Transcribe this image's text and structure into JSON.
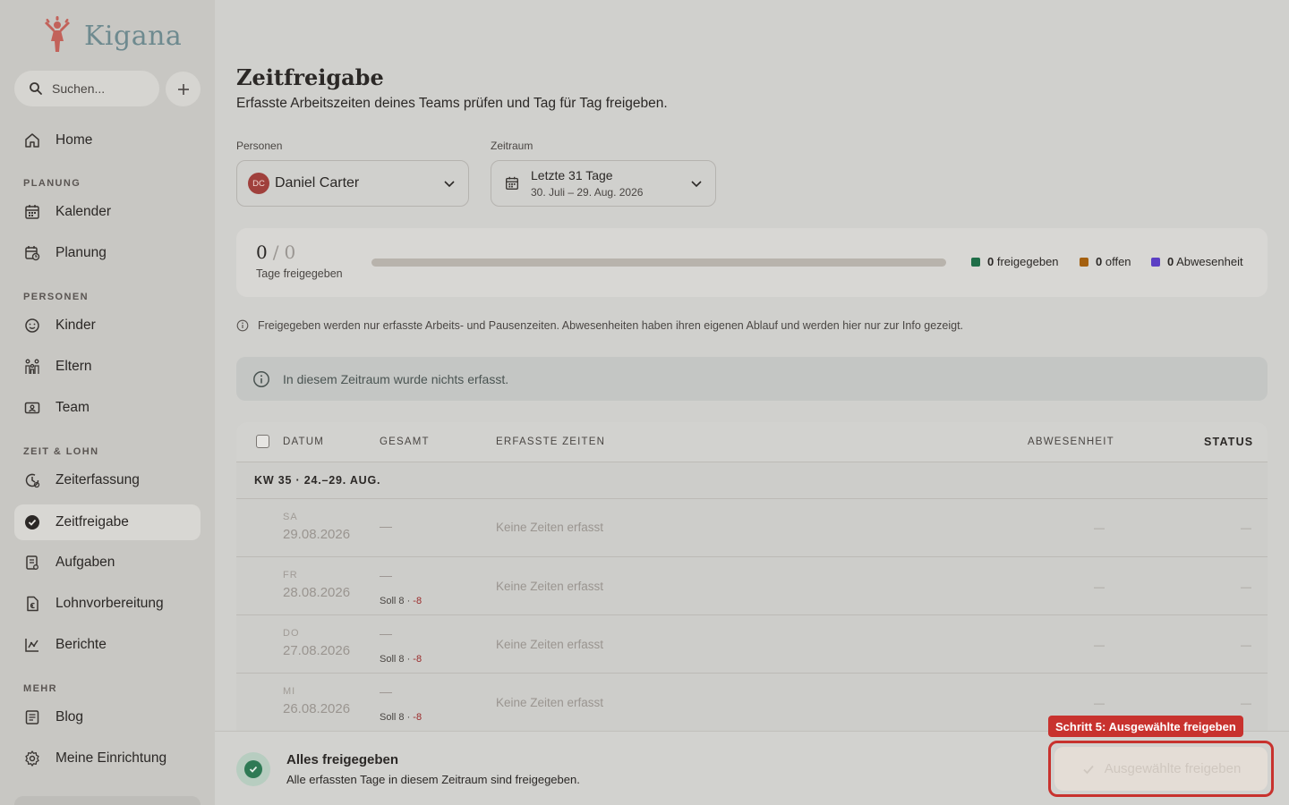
{
  "brand": {
    "name": "Kigana"
  },
  "search": {
    "placeholder": "Suchen..."
  },
  "sidebar": {
    "home": "Home",
    "sections": [
      "PLANUNG",
      "PERSONEN",
      "ZEIT & LOHN",
      "MEHR"
    ],
    "items": {
      "kalender": "Kalender",
      "planung": "Planung",
      "kinder": "Kinder",
      "eltern": "Eltern",
      "team": "Team",
      "zeiterfassung": "Zeiterfassung",
      "zeitfreigabe": "Zeitfreigabe",
      "aufgaben": "Aufgaben",
      "lohnvorbereitung": "Lohnvorbereitung",
      "berichte": "Berichte",
      "blog": "Blog",
      "einrichtung": "Meine Einrichtung"
    },
    "active": "zeitfreigabe"
  },
  "page": {
    "title": "Zeitfreigabe",
    "subtitle": "Erfasste Arbeitszeiten deines Teams prüfen und Tag für Tag freigeben."
  },
  "filters": {
    "persons_label": "Personen",
    "person_initials": "DC",
    "person_name": "Daniel Carter",
    "range_label": "Zeitraum",
    "range_title": "Letzte 31 Tage",
    "range_dates": "30. Juli – 29. Aug. 2026"
  },
  "summary": {
    "approved": "0",
    "total": "0",
    "label": "Tage freigegeben",
    "progress": 0,
    "legend": [
      {
        "count": "0",
        "label": "freigegeben",
        "color": "#1f6e48"
      },
      {
        "count": "0",
        "label": "offen",
        "color": "#a4600f"
      },
      {
        "count": "0",
        "label": "Abwesenheit",
        "color": "#5b3fc4"
      }
    ]
  },
  "notes": {
    "info": "Freigegeben werden nur erfasste Arbeits- und Pausenzeiten. Abwesenheiten haben ihren eigenen Ablauf und werden hier nur zur Info gezeigt.",
    "empty": "In diesem Zeitraum wurde nichts erfasst."
  },
  "table": {
    "columns": {
      "date": "DATUM",
      "total": "GESAMT",
      "times": "ERFASSTE ZEITEN",
      "absence": "ABWESENHEIT",
      "status": "STATUS"
    },
    "week": "KW 35 · 24.–29. AUG.",
    "rows": [
      {
        "weekday": "SA",
        "date": "29.08.2026",
        "total": "—",
        "soll": "",
        "diff": "",
        "times": "Keine Zeiten erfasst",
        "absence": "—",
        "status": "—"
      },
      {
        "weekday": "FR",
        "date": "28.08.2026",
        "total": "—",
        "soll": "Soll 8 · ",
        "diff": "-8",
        "times": "Keine Zeiten erfasst",
        "absence": "—",
        "status": "—"
      },
      {
        "weekday": "DO",
        "date": "27.08.2026",
        "total": "—",
        "soll": "Soll 8 · ",
        "diff": "-8",
        "times": "Keine Zeiten erfasst",
        "absence": "—",
        "status": "—"
      },
      {
        "weekday": "MI",
        "date": "26.08.2026",
        "total": "—",
        "soll": "Soll 8 · ",
        "diff": "-8",
        "times": "Keine Zeiten erfasst",
        "absence": "—",
        "status": "—"
      }
    ]
  },
  "footer": {
    "title": "Alles freigegeben",
    "subtitle": "Alle erfassten Tage in diesem Zeitraum sind freigegeben.",
    "approve_label": "Ausgewählte freigeben",
    "step_tag": "Schritt 5: Ausgewählte freigeben"
  }
}
